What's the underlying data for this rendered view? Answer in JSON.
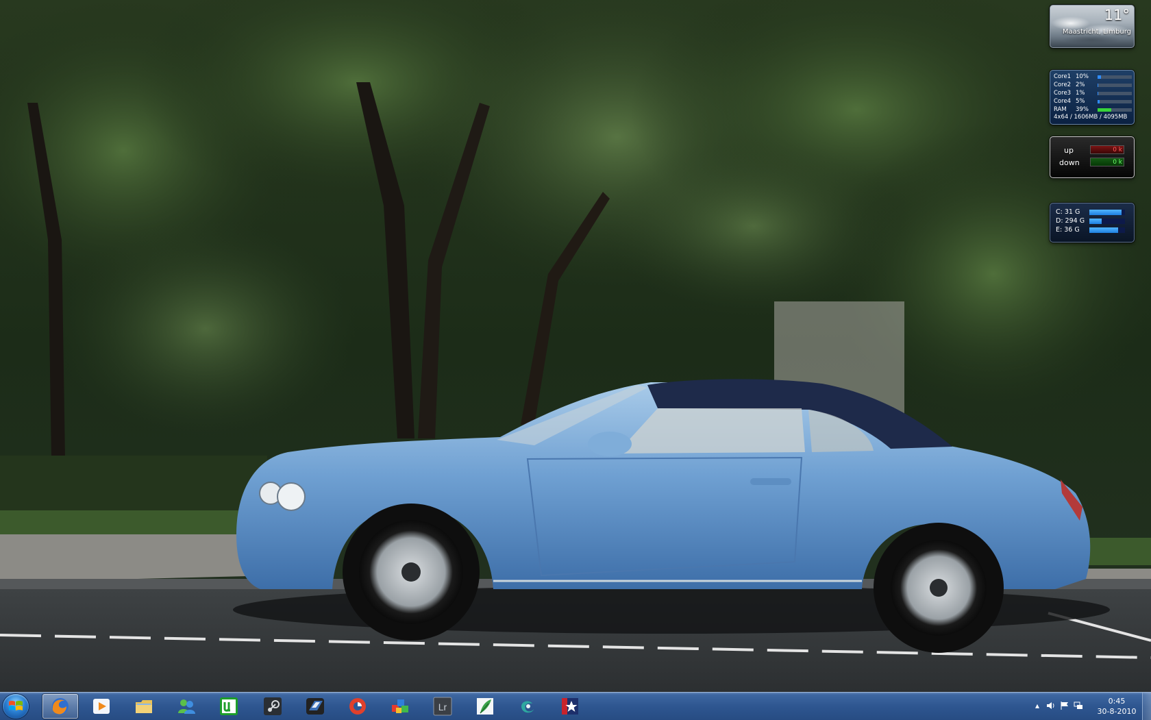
{
  "desktop": {
    "wallpaper_subject": "Light-blue convertible parked under trees"
  },
  "gadgets": {
    "weather": {
      "temperature": "11°",
      "location": "Maastricht, Limburg"
    },
    "cpu_meter": {
      "rows": [
        {
          "label": "Core1",
          "percent": "10%",
          "value": 10
        },
        {
          "label": "Core2",
          "percent": "2%",
          "value": 2
        },
        {
          "label": "Core3",
          "percent": "1%",
          "value": 1
        },
        {
          "label": "Core4",
          "percent": "5%",
          "value": 5
        },
        {
          "label": "RAM",
          "percent": "39%",
          "value": 39
        }
      ],
      "footer": "4x64 / 1606MB / 4095MB"
    },
    "network": {
      "up_label": "up",
      "up_value": "0 k",
      "down_label": "down",
      "down_value": "0 k"
    },
    "drives": {
      "items": [
        {
          "label": "C: 31 G",
          "fill_fraction": 0.9
        },
        {
          "label": "D: 294 G",
          "fill_fraction": 0.35
        },
        {
          "label": "E: 36 G",
          "fill_fraction": 0.8
        }
      ]
    }
  },
  "taskbar": {
    "start_icon": "windows-logo-icon",
    "pinned": [
      {
        "name": "firefox",
        "icon": "firefox-icon",
        "active": true
      },
      {
        "name": "media-player",
        "icon": "media-player-icon",
        "active": false
      },
      {
        "name": "explorer",
        "icon": "folder-icon",
        "active": false
      },
      {
        "name": "messenger",
        "icon": "messenger-icon",
        "active": false
      },
      {
        "name": "utorrent",
        "icon": "utorrent-icon",
        "active": false
      },
      {
        "name": "steam",
        "icon": "steam-icon",
        "active": false
      },
      {
        "name": "hd-tool",
        "icon": "hd-tool-icon",
        "active": false
      },
      {
        "name": "ccleaner",
        "icon": "ccleaner-icon",
        "active": false
      },
      {
        "name": "cubes-app",
        "icon": "cubes-icon",
        "active": false
      },
      {
        "name": "lightroom",
        "icon": "lightroom-icon",
        "active": false,
        "text": "Lr"
      },
      {
        "name": "feather-app",
        "icon": "feather-icon",
        "active": false
      },
      {
        "name": "galaxy-app",
        "icon": "galaxy-icon",
        "active": false
      },
      {
        "name": "star-app",
        "icon": "star-icon",
        "active": false
      }
    ],
    "tray": {
      "time": "0:45",
      "date": "30-8-2010"
    }
  },
  "colors": {
    "taskbar": "#2e5690",
    "cpu_bar": "#2f8cff",
    "ram_bar": "#39d439"
  }
}
